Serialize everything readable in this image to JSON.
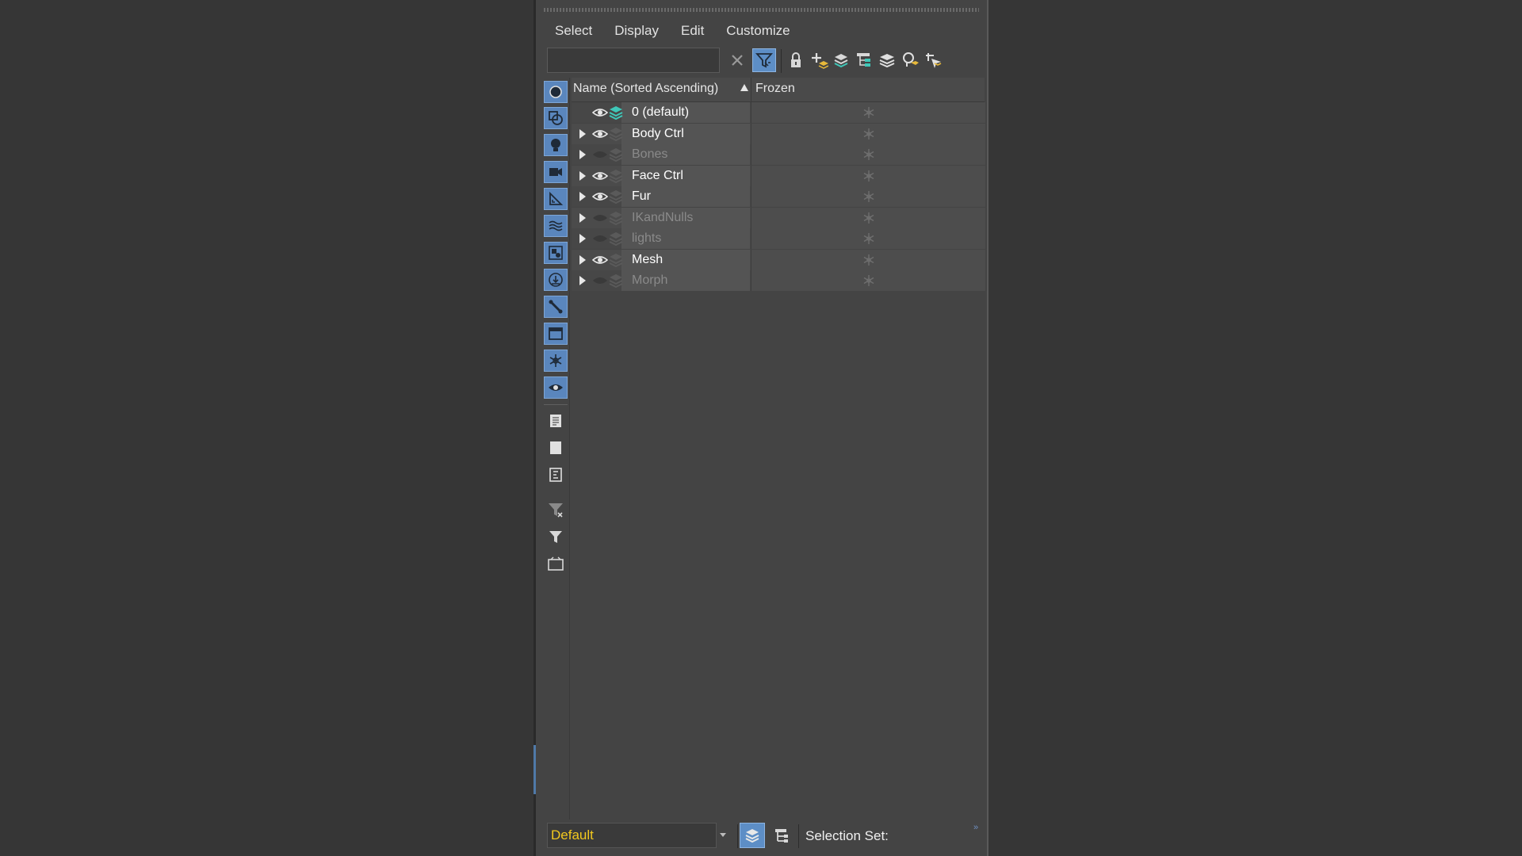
{
  "menu": [
    "Select",
    "Display",
    "Edit",
    "Customize"
  ],
  "search": {
    "value": "",
    "placeholder": ""
  },
  "toolbar": {
    "icons": [
      "clear-icon",
      "filter-icon",
      "lock-icon",
      "add-layer-icon",
      "add-selection-icon",
      "nest-layer-icon",
      "layers-icon",
      "highlight-icon",
      "select-icon"
    ],
    "active": "filter-icon"
  },
  "side_toolbar": {
    "icons": [
      "geometry-icon",
      "shapes-icon",
      "lights-icon",
      "cameras-icon",
      "helpers-icon",
      "space-warps-icon",
      "groups-icon",
      "xrefs-icon",
      "bones-icon",
      "containers-icon",
      "frozen-icon",
      "hidden-icon",
      "list-icon",
      "select-all-icon",
      "invert-icon",
      "filter-outline-icon",
      "filter-icon",
      "container-filter-icon"
    ],
    "active_count": 12
  },
  "columns": {
    "name": "Name (Sorted Ascending)",
    "frozen": "Frozen"
  },
  "layers": [
    {
      "name": "0 (default)",
      "visible": true,
      "expandable": false,
      "current": true
    },
    {
      "name": "Body Ctrl",
      "visible": true,
      "expandable": true,
      "current": false
    },
    {
      "name": "Bones",
      "visible": false,
      "expandable": true,
      "current": false
    },
    {
      "name": "Face Ctrl",
      "visible": true,
      "expandable": true,
      "current": false
    },
    {
      "name": "Fur",
      "visible": true,
      "expandable": true,
      "current": false
    },
    {
      "name": "IKandNulls",
      "visible": false,
      "expandable": true,
      "current": false
    },
    {
      "name": "lights",
      "visible": false,
      "expandable": true,
      "current": false
    },
    {
      "name": "Mesh",
      "visible": true,
      "expandable": true,
      "current": false
    },
    {
      "name": "Morph",
      "visible": false,
      "expandable": true,
      "current": false
    }
  ],
  "bottom": {
    "layer_dropdown": "Default",
    "selection_set_label": "Selection Set:",
    "chevron": "»"
  },
  "colors": {
    "accent": "#5d8ec6",
    "panel": "#444444",
    "background": "#363636",
    "current_layer_text": "#f2c81e",
    "layer_icon_active": "#3fc7b8"
  }
}
